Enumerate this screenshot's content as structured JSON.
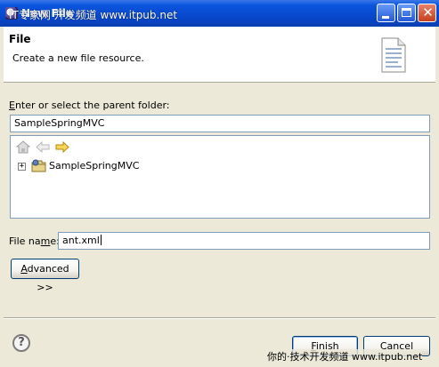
{
  "window": {
    "title": "New File",
    "watermark_top": "IT专家网 开发频道  www.itpub.net",
    "watermark_bottom": "你的·技术开发频道  www.itpub.net",
    "controls": [
      "minimize",
      "maximize",
      "close"
    ],
    "close_glyph": "✕"
  },
  "header": {
    "title": "File",
    "description": "Create a new file resource."
  },
  "parent_folder": {
    "label_prefix": "E",
    "label_rest": "nter or select the parent folder:",
    "value": "SampleSpringMVC"
  },
  "tree": {
    "nav_icons": [
      "home-icon",
      "back-icon",
      "forward-icon"
    ],
    "items": [
      {
        "label": "SampleSpringMVC",
        "expander": "+",
        "icon": "project-folder-icon"
      }
    ]
  },
  "file_name": {
    "label_prefix": "File na",
    "label_u": "m",
    "label_rest": "e:",
    "value": "ant.xml"
  },
  "advanced_button": {
    "label_u": "A",
    "label_rest": "dvanced >>"
  },
  "footer": {
    "help_glyph": "?",
    "finish_label_u": "F",
    "finish_label_rest": "inish",
    "cancel_label": "Cancel"
  },
  "colors": {
    "titlebar": "#0a55de",
    "dialog_bg": "#ece9d8",
    "field_border": "#7f9db9",
    "button_border": "#003c74"
  }
}
